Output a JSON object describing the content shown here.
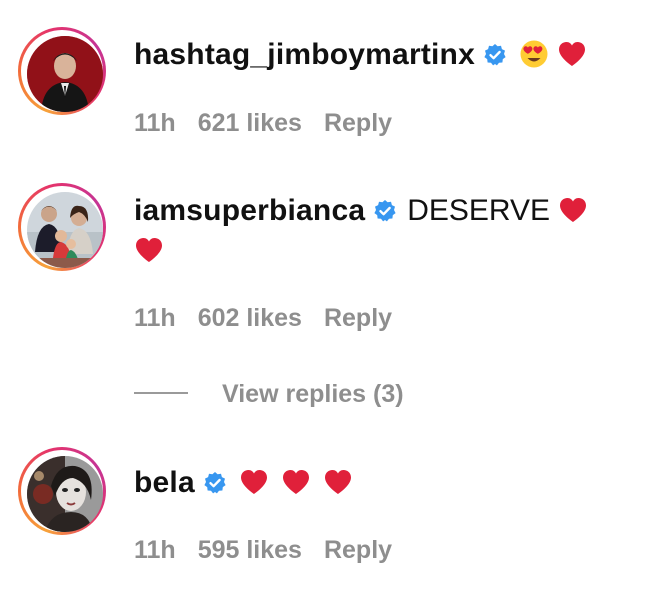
{
  "comments": [
    {
      "username": "hashtag_jimboymartinx",
      "verified": true,
      "text": "",
      "emojis": [
        "heart-eyes",
        "red-heart"
      ],
      "time": "11h",
      "likes": "621 likes",
      "reply": "Reply",
      "avatar_icon": "man-in-suit-red-background"
    },
    {
      "username": "iamsuperbianca",
      "verified": true,
      "text": "DESERVE",
      "emojis": [
        "red-heart",
        "red-heart"
      ],
      "time": "11h",
      "likes": "602 likes",
      "reply": "Reply",
      "avatar_icon": "family-photo",
      "view_replies": "View replies (3)"
    },
    {
      "username": "bela",
      "verified": true,
      "text": "",
      "emojis": [
        "red-heart",
        "red-heart",
        "red-heart"
      ],
      "time": "11h",
      "likes": "595 likes",
      "reply": "Reply",
      "avatar_icon": "woman-portrait"
    }
  ],
  "colors": {
    "verified_blue": "#3897f0",
    "heart_red": "#e0203a",
    "meta_gray": "#8e8e8e"
  }
}
